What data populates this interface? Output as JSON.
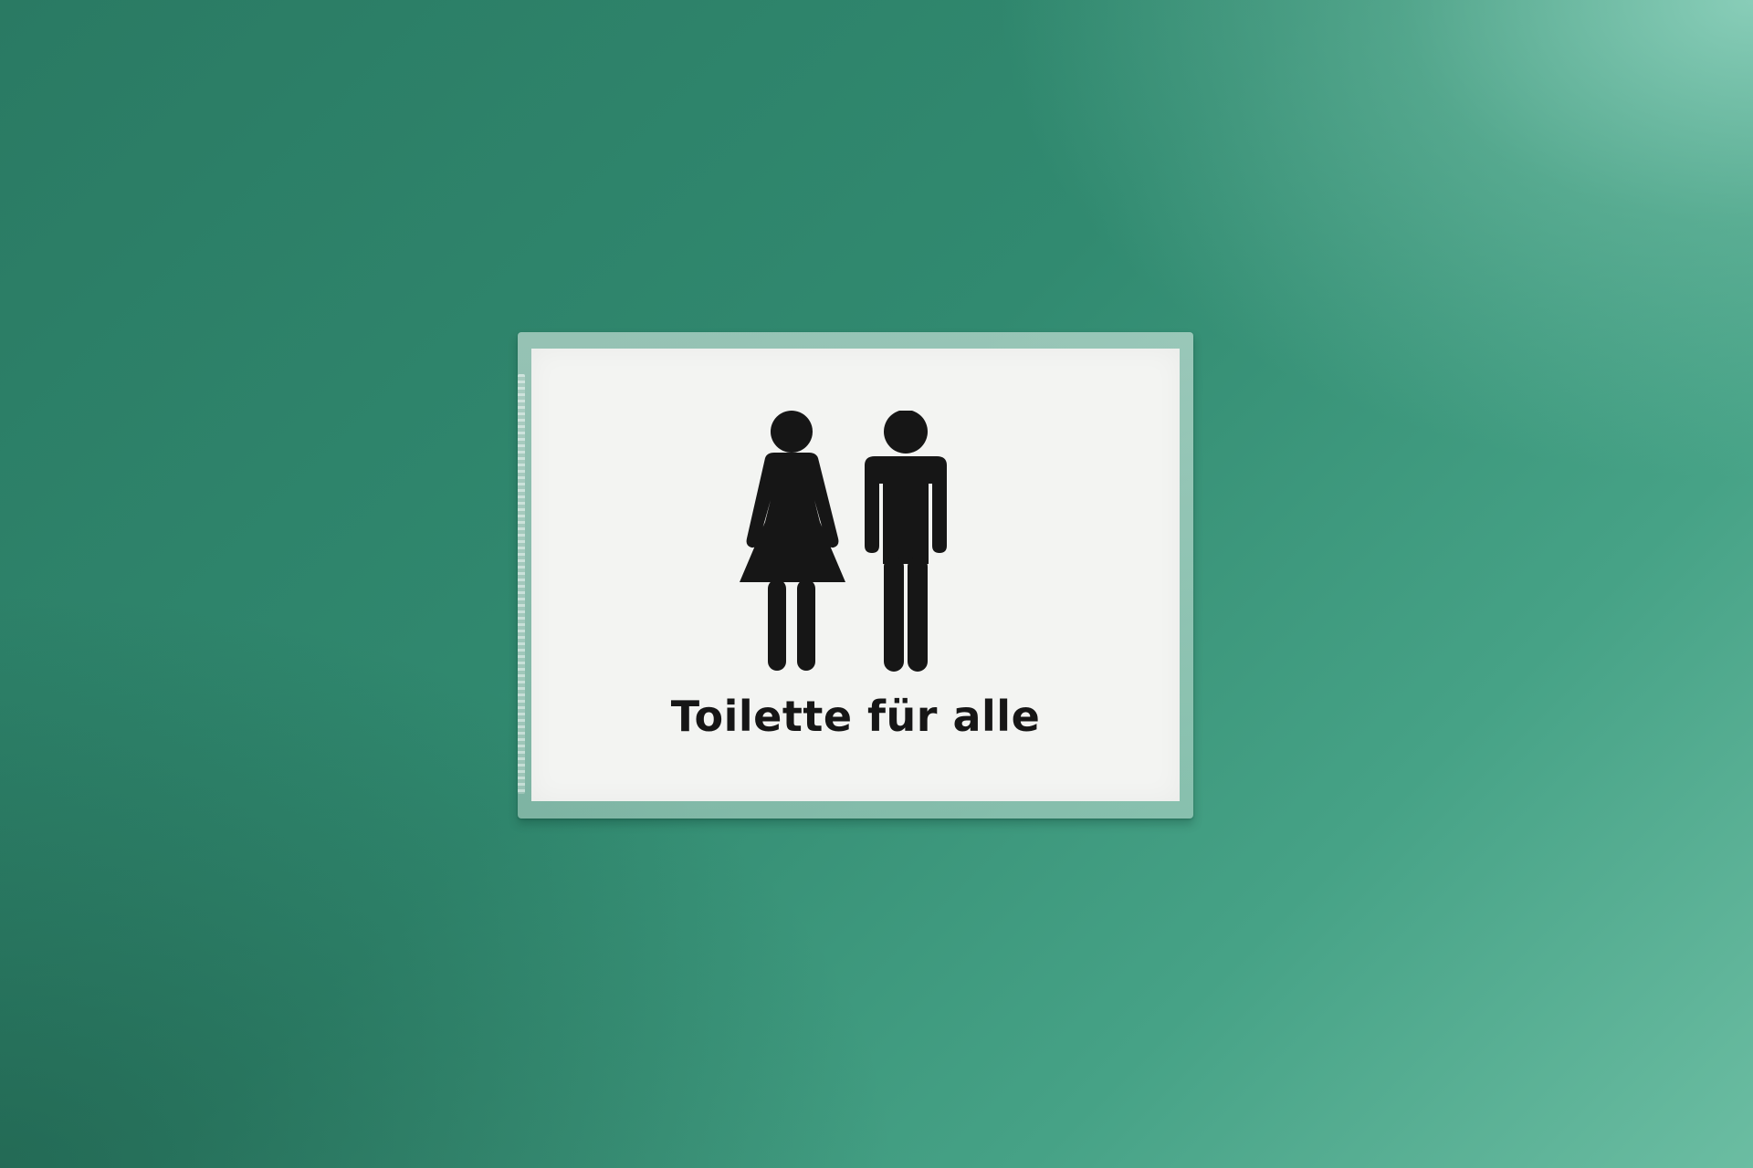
{
  "scene": {
    "wall_color": "#318a70",
    "paper_color": "#f3f4f2",
    "ink_color": "#161616"
  },
  "sign": {
    "text": "Toilette für alle",
    "icons": [
      "woman-icon",
      "man-icon"
    ]
  }
}
